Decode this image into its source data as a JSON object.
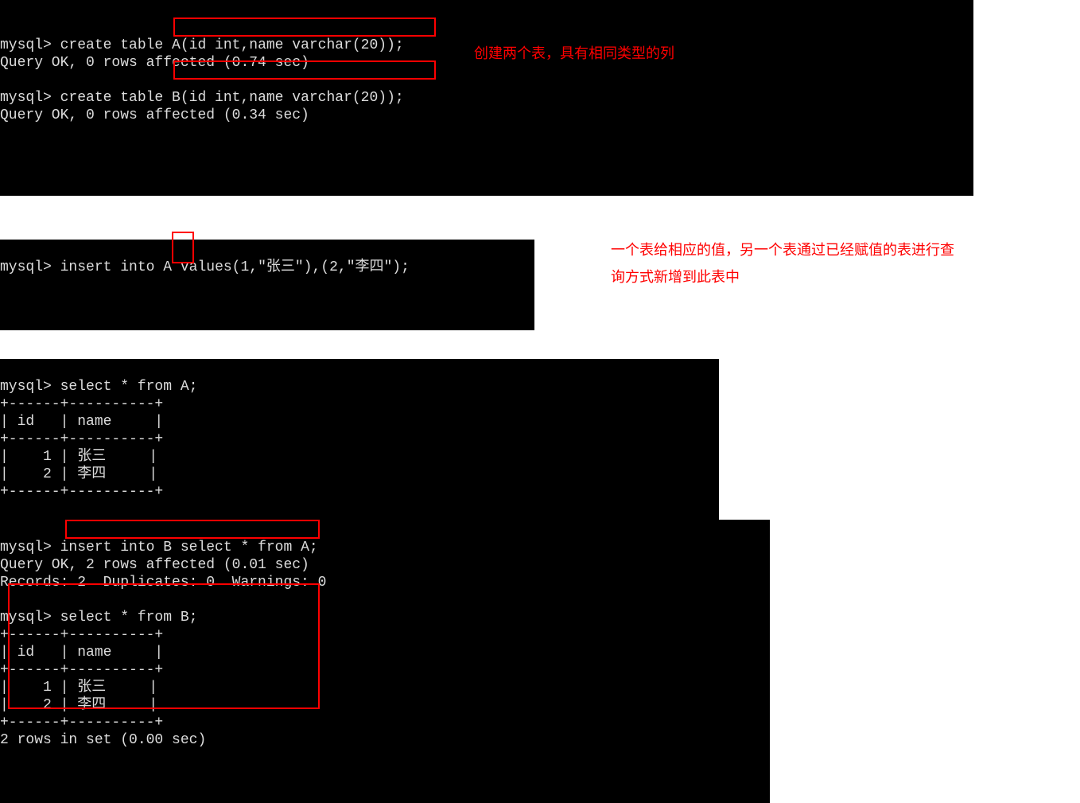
{
  "block1": {
    "line0_partial": "                                                                 ",
    "prompt": "mysql>",
    "create_a_pre": " create table ",
    "create_a_hl": "A(id int,name varchar(20));",
    "create_a_result": "Query OK, 0 rows affected (0.74 sec)",
    "blank": "",
    "create_b_pre": " create table ",
    "create_b_hl": "B(id int,name varchar(20));",
    "create_b_result": "Query OK, 0 rows affected (0.34 sec)",
    "annotation": "创建两个表，具有相同类型的列"
  },
  "block2": {
    "insert_pre": " insert into ",
    "insert_hl": "A",
    "insert_post": " values(1,\"张三\"),(2,\"李四\");  ",
    "annotation": "一个表给相应的值，另一个表通过已经赋值的表进行查询方式新增到此表中"
  },
  "block3": {
    "select_a": " select * from A;",
    "divider": "+------+----------+",
    "header": "| id   | name     |",
    "row1": "|    1 | 张三     |",
    "row2": "|    2 | 李四     |"
  },
  "block4": {
    "insert_b": "insert into B select * from A;",
    "insert_b_result1": "Query OK, 2 rows affected (0.01 sec)",
    "insert_b_result2": "Records: 2  Duplicates: 0  Warnings: 0",
    "select_b": " select * from B;",
    "divider": "+------+----------+",
    "header": "| id   | name     |",
    "row1": "|    1 | 张三     |",
    "row2": "|    2 | 李四     |",
    "footer": "2 rows in set (0.00 sec)"
  }
}
